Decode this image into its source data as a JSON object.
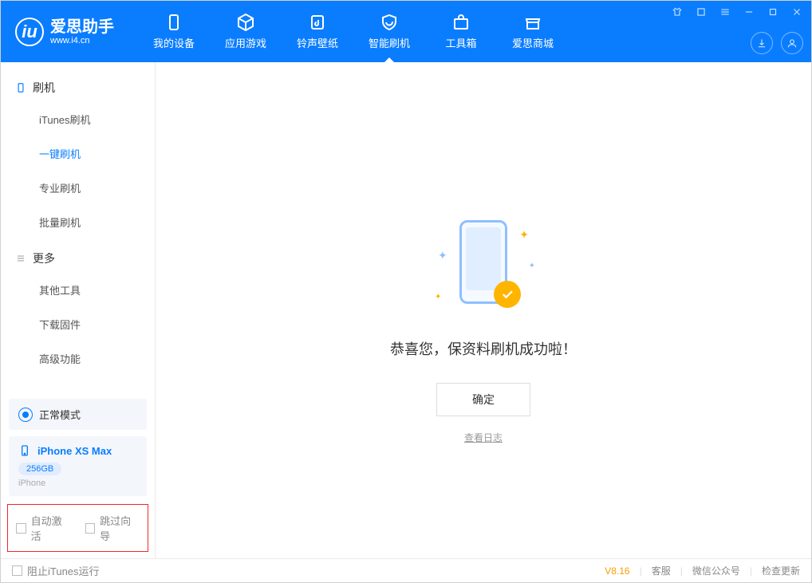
{
  "app": {
    "title": "爱思助手",
    "subtitle": "www.i4.cn"
  },
  "nav": {
    "device": "我的设备",
    "apps": "应用游戏",
    "ringtone": "铃声壁纸",
    "flash": "智能刷机",
    "toolbox": "工具箱",
    "store": "爱思商城"
  },
  "sidebar": {
    "section_flash": "刷机",
    "itunes_flash": "iTunes刷机",
    "one_click_flash": "一键刷机",
    "pro_flash": "专业刷机",
    "batch_flash": "批量刷机",
    "section_more": "更多",
    "other_tools": "其他工具",
    "download_fw": "下载固件",
    "adv_func": "高级功能"
  },
  "device": {
    "mode": "正常模式",
    "name": "iPhone XS Max",
    "storage": "256GB",
    "type": "iPhone"
  },
  "options": {
    "auto_activate": "自动激活",
    "skip_guide": "跳过向导"
  },
  "main": {
    "success_title": "恭喜您，保资料刷机成功啦！",
    "ok_button": "确定",
    "view_log": "查看日志"
  },
  "footer": {
    "block_itunes": "阻止iTunes运行",
    "version": "V8.16",
    "support": "客服",
    "wechat": "微信公众号",
    "check_update": "检查更新"
  }
}
